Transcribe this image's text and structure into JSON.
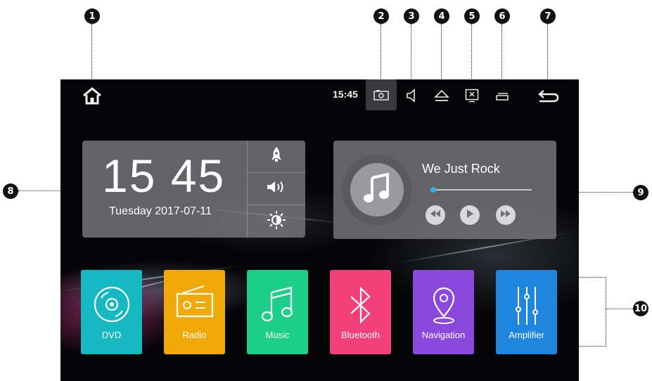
{
  "status_bar": {
    "time": "15:45",
    "icons": [
      "home-icon",
      "camera-icon",
      "volume-icon",
      "eject-icon",
      "screen-off-icon",
      "recent-apps-icon",
      "back-icon"
    ]
  },
  "callouts": [
    "1",
    "2",
    "3",
    "4",
    "5",
    "6",
    "7",
    "8",
    "9",
    "10"
  ],
  "clock_widget": {
    "time": "15 45",
    "date": "Tuesday  2017-07-11",
    "side_icons": [
      "rocket-icon",
      "volume-icon",
      "brightness-icon"
    ]
  },
  "music_widget": {
    "song": "We Just Rock",
    "progress": 0.03
  },
  "apps": [
    {
      "label": "DVD",
      "color": "#16b9c2",
      "icon": "disc-icon"
    },
    {
      "label": "Radio",
      "color": "#f1a90a",
      "icon": "radio-icon"
    },
    {
      "label": "Music",
      "color": "#1ccf88",
      "icon": "music-note-icon"
    },
    {
      "label": "Bluetooth",
      "color": "#f1407a",
      "icon": "bluetooth-icon"
    },
    {
      "label": "Navigation",
      "color": "#8a48df",
      "icon": "location-pin-icon"
    },
    {
      "label": "Amplifier",
      "color": "#1f86dd",
      "icon": "equalizer-icon"
    }
  ]
}
